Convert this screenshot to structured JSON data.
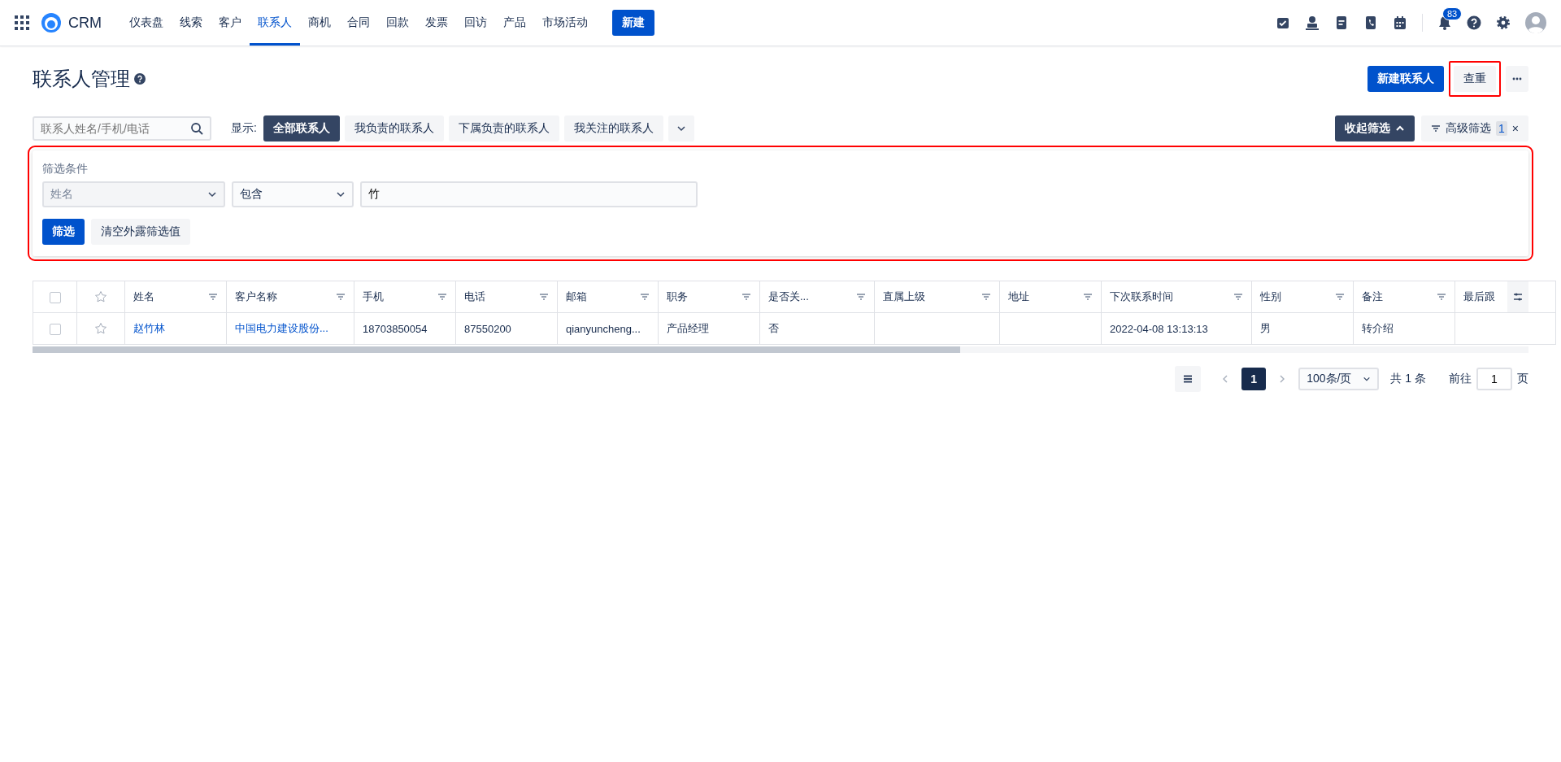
{
  "nav": {
    "app_name": "CRM",
    "items": [
      {
        "label": "仪表盘",
        "selected": false
      },
      {
        "label": "线索",
        "selected": false
      },
      {
        "label": "客户",
        "selected": false
      },
      {
        "label": "联系人",
        "selected": true
      },
      {
        "label": "商机",
        "selected": false
      },
      {
        "label": "合同",
        "selected": false
      },
      {
        "label": "回款",
        "selected": false
      },
      {
        "label": "发票",
        "selected": false
      },
      {
        "label": "回访",
        "selected": false
      },
      {
        "label": "产品",
        "selected": false
      },
      {
        "label": "市场活动",
        "selected": false
      }
    ],
    "new_button": "新建",
    "notification_count": "83"
  },
  "page": {
    "title": "联系人管理",
    "new_contact_button": "新建联系人",
    "dedupe_button": {
      "label": "查重",
      "highlighted": true
    }
  },
  "toolbar": {
    "search_placeholder": "联系人姓名/手机/电话",
    "show_label": "显示:",
    "views": [
      {
        "label": "全部联系人",
        "selected": true
      },
      {
        "label": "我负责的联系人",
        "selected": false
      },
      {
        "label": "下属负责的联系人",
        "selected": false
      },
      {
        "label": "我关注的联系人",
        "selected": false
      }
    ],
    "collapse_button": "收起筛选",
    "advanced_filter": {
      "label": "高级筛选",
      "count": "1",
      "clear": "×"
    }
  },
  "filter_panel": {
    "highlighted": true,
    "title": "筛选条件",
    "field": {
      "placeholder": "姓名"
    },
    "operator": "包含",
    "value": "竹",
    "apply_button": "筛选",
    "clear_button": "清空外露筛选值"
  },
  "table": {
    "all_checked": false,
    "columns": [
      "姓名",
      "客户名称",
      "手机",
      "电话",
      "邮箱",
      "职务",
      "是否关...",
      "直属上级",
      "地址",
      "下次联系时间",
      "性别",
      "备注",
      "最后跟"
    ],
    "rows": [
      {
        "checked": false,
        "starred": false,
        "cells": [
          {
            "text": "赵竹林",
            "link": true
          },
          {
            "text": "中国电力建设股份...",
            "link": true
          },
          {
            "text": "18703850054",
            "link": false
          },
          {
            "text": "87550200",
            "link": false
          },
          {
            "text": "qianyuncheng...",
            "link": false
          },
          {
            "text": "产品经理",
            "link": false
          },
          {
            "text": "否",
            "link": false
          },
          {},
          {},
          {
            "text": "2022-04-08 13:13:13",
            "link": false
          },
          {
            "text": "男",
            "link": false
          },
          {
            "text": "转介绍",
            "link": false
          },
          {}
        ]
      }
    ]
  },
  "pagination": {
    "current_page": "1",
    "page_size": "100条/页",
    "total": "共 1 条",
    "goto_label": "前往",
    "goto_value": "1",
    "page_suffix": "页"
  }
}
